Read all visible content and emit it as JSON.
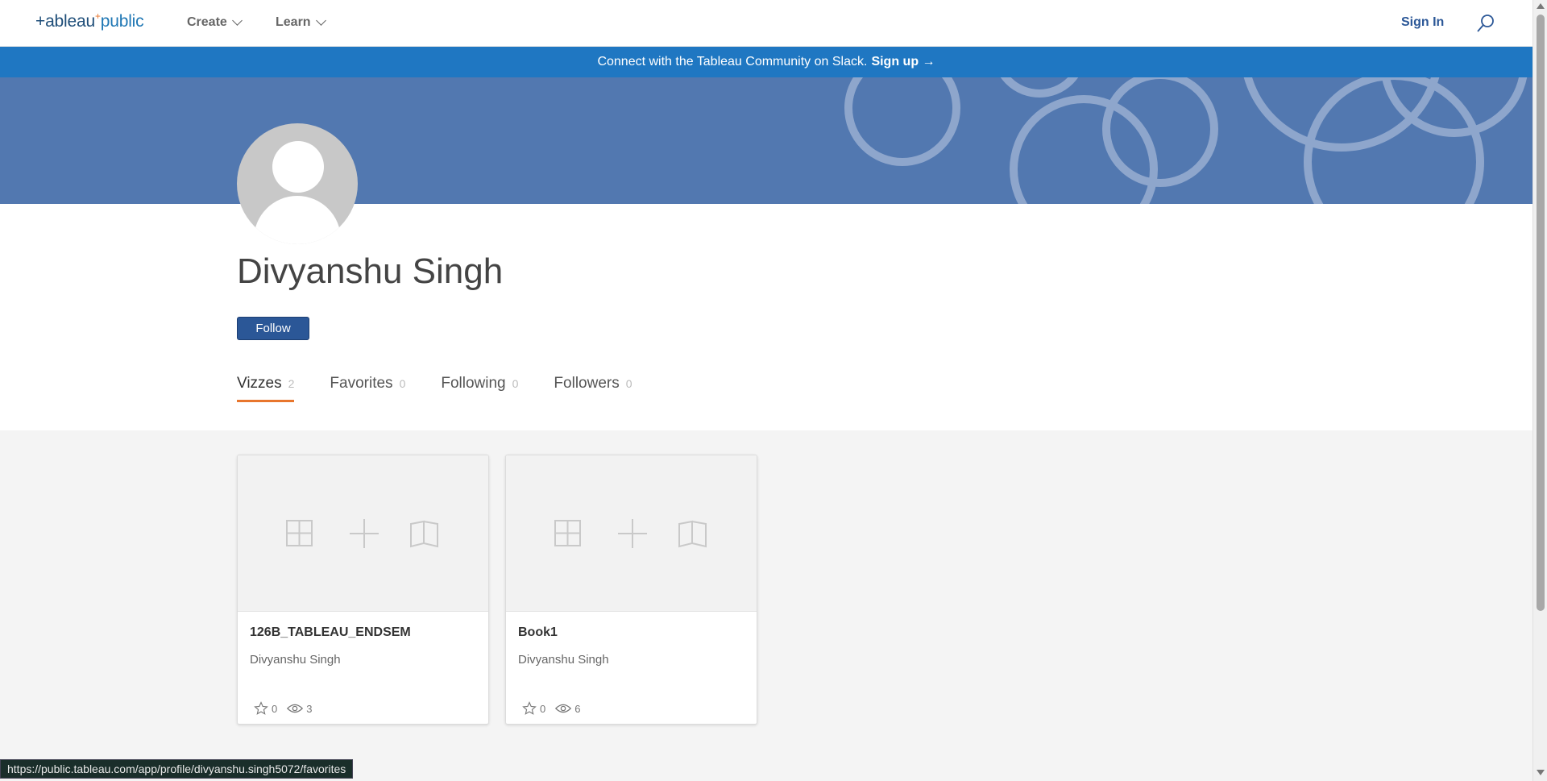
{
  "nav": {
    "logo_main": "+ableau",
    "logo_sparkle": "+",
    "logo_public": "public",
    "items": [
      {
        "label": "Create"
      },
      {
        "label": "Learn"
      }
    ],
    "signin": "Sign In"
  },
  "banner": {
    "text": "Connect with the Tableau Community on Slack.",
    "link": "Sign up →"
  },
  "profile": {
    "name": "Divyanshu Singh",
    "follow_label": "Follow",
    "tabs": [
      {
        "label": "Vizzes",
        "count": "2",
        "active": true
      },
      {
        "label": "Favorites",
        "count": "0"
      },
      {
        "label": "Following",
        "count": "0"
      },
      {
        "label": "Followers",
        "count": "0"
      }
    ]
  },
  "vizzes": [
    {
      "title": "126B_TABLEAU_ENDSEM",
      "author": "Divyanshu Singh",
      "favorites": "0",
      "views": "3"
    },
    {
      "title": "Book1",
      "author": "Divyanshu Singh",
      "favorites": "0",
      "views": "6"
    }
  ],
  "status_url": "https://public.tableau.com/app/profile/divyanshu.singh5072/favorites",
  "colors": {
    "brand_blue": "#2b5797",
    "banner_blue": "#1f77c2",
    "hero_blue": "#5278b0",
    "accent_orange": "#e8762d"
  }
}
